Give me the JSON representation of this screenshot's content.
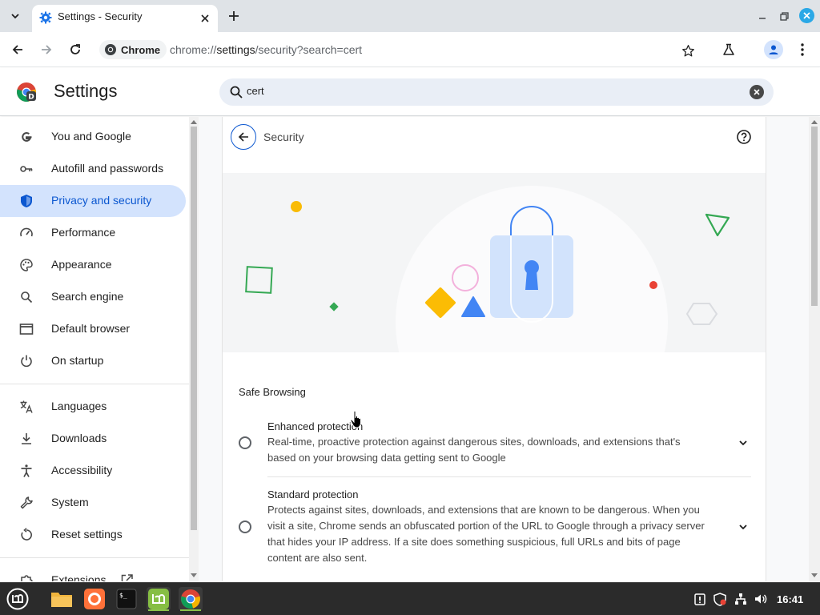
{
  "tab": {
    "title": "Settings - Security"
  },
  "toolbar": {
    "chip_label": "Chrome",
    "url_scheme": "chrome://",
    "url_host": "settings",
    "url_path": "/security?search=cert"
  },
  "header": {
    "title": "Settings",
    "search_value": "cert"
  },
  "sidebar": {
    "items": [
      {
        "label": "You and Google",
        "icon": "google-g-icon"
      },
      {
        "label": "Autofill and passwords",
        "icon": "key-icon"
      },
      {
        "label": "Privacy and security",
        "icon": "shield-icon",
        "active": true
      },
      {
        "label": "Performance",
        "icon": "speedometer-icon"
      },
      {
        "label": "Appearance",
        "icon": "palette-icon"
      },
      {
        "label": "Search engine",
        "icon": "search-icon"
      },
      {
        "label": "Default browser",
        "icon": "browser-window-icon"
      },
      {
        "label": "On startup",
        "icon": "power-icon"
      },
      {
        "label": "Languages",
        "icon": "translate-icon"
      },
      {
        "label": "Downloads",
        "icon": "download-icon"
      },
      {
        "label": "Accessibility",
        "icon": "accessibility-icon"
      },
      {
        "label": "System",
        "icon": "wrench-icon"
      },
      {
        "label": "Reset settings",
        "icon": "reset-icon"
      },
      {
        "label": "Extensions",
        "icon": "puzzle-icon",
        "external": "open-in-new-icon"
      }
    ]
  },
  "main": {
    "page_title": "Security",
    "safe_browsing_heading": "Safe Browsing",
    "options": [
      {
        "title": "Enhanced protection",
        "description": "Real-time, proactive protection against dangerous sites, downloads, and extensions that's based on your browsing data getting sent to Google"
      },
      {
        "title": "Standard protection",
        "description": "Protects against sites, downloads, and extensions that are known to be dangerous. When you visit a site, Chrome sends an obfuscated portion of the URL to Google through a privacy server that hides your IP address. If a site does something suspicious, full URLs and bits of page content are also sent."
      }
    ]
  },
  "taskbar": {
    "clock": "16:41"
  },
  "colors": {
    "accent": "#0b57d0",
    "active_nav_bg": "#d3e3fd",
    "search_bg": "#e9eef6",
    "taskbar_bg": "#2b2b2b"
  }
}
